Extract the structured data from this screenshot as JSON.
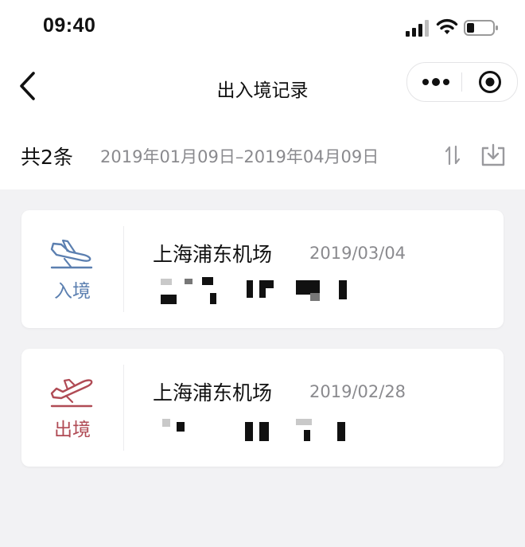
{
  "status_bar": {
    "time": "09:40"
  },
  "nav": {
    "title": "出入境记录"
  },
  "summary": {
    "count": "共2条",
    "date_range": "2019年01月09日–2019年04月09日"
  },
  "records": [
    {
      "direction": "入境",
      "airport": "上海浦东机场",
      "date": "2019/03/04",
      "icon": "plane-landing-icon",
      "color": "#5b7fb0"
    },
    {
      "direction": "出境",
      "airport": "上海浦东机场",
      "date": "2019/02/28",
      "icon": "plane-takeoff-icon",
      "color": "#b04b55"
    }
  ],
  "colors": {
    "page_background": "#f2f2f4",
    "card_background": "#ffffff",
    "secondary_text": "#8a8a8e"
  }
}
